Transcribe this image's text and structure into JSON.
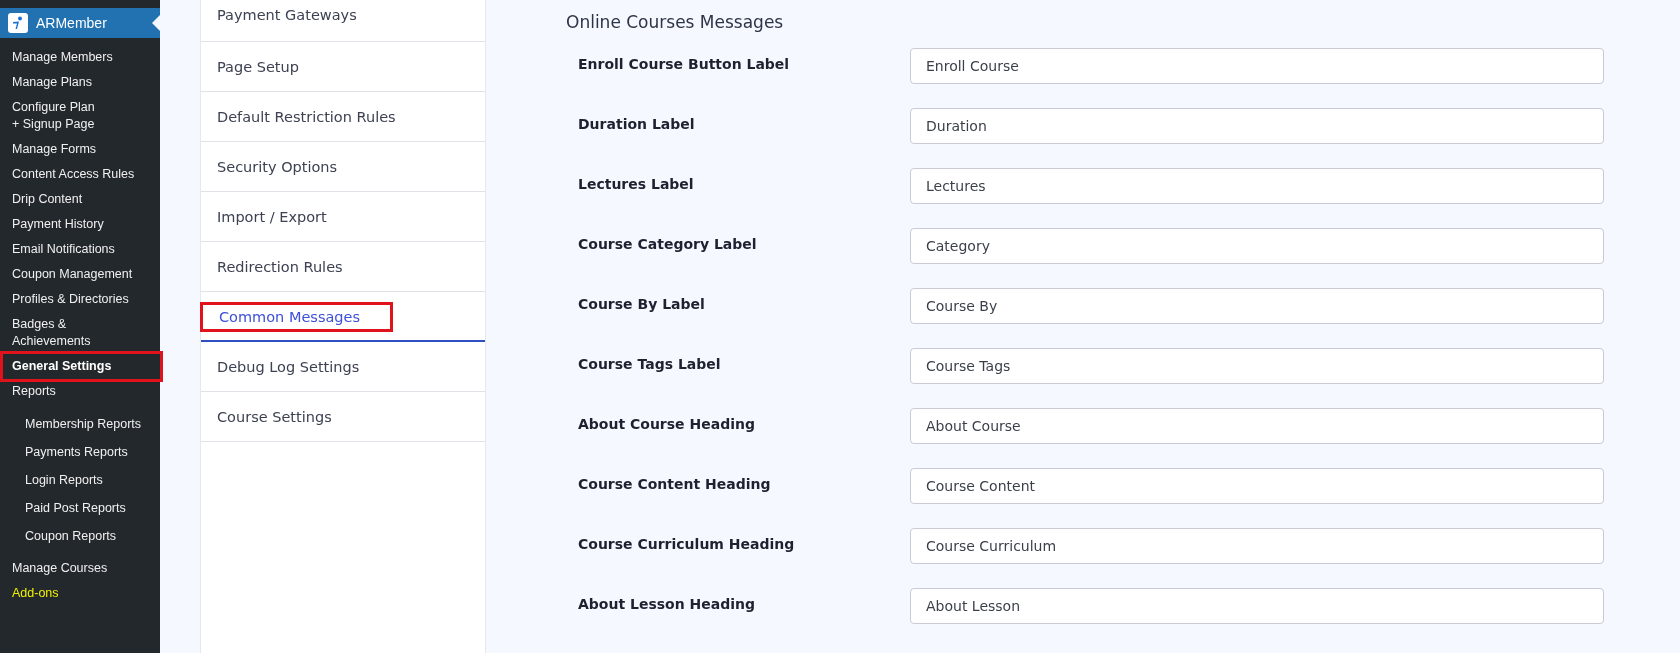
{
  "sidebar": {
    "header": {
      "title": "ARMember"
    },
    "items": [
      {
        "label": "Manage Members",
        "selected": false,
        "highlighted": false
      },
      {
        "label": "Manage Plans",
        "selected": false,
        "highlighted": false
      },
      {
        "label": "Configure Plan + Signup Page",
        "selected": false,
        "highlighted": false
      },
      {
        "label": "Manage Forms",
        "selected": false,
        "highlighted": false
      },
      {
        "label": "Content Access Rules",
        "selected": false,
        "highlighted": false
      },
      {
        "label": "Drip Content",
        "selected": false,
        "highlighted": false
      },
      {
        "label": "Payment History",
        "selected": false,
        "highlighted": false
      },
      {
        "label": "Email Notifications",
        "selected": false,
        "highlighted": false
      },
      {
        "label": "Coupon Management",
        "selected": false,
        "highlighted": false
      },
      {
        "label": "Profiles & Directories",
        "selected": false,
        "highlighted": false
      },
      {
        "label": "Badges & Achievements",
        "selected": false,
        "highlighted": false
      },
      {
        "label": "General Settings",
        "selected": true,
        "highlighted": true
      },
      {
        "label": "Reports",
        "selected": false,
        "highlighted": false,
        "children": [
          {
            "label": "Membership Reports"
          },
          {
            "label": "Payments Reports"
          },
          {
            "label": "Login Reports"
          },
          {
            "label": "Paid Post Reports"
          },
          {
            "label": "Coupon Reports"
          }
        ]
      },
      {
        "label": "Manage Courses",
        "selected": false,
        "highlighted": false
      },
      {
        "label": "Add-ons",
        "selected": false,
        "highlighted": false,
        "kind": "addon"
      }
    ]
  },
  "settings_menu": [
    {
      "label": "Payment Gateways",
      "selected": false,
      "highlighted": false
    },
    {
      "label": "Page Setup",
      "selected": false,
      "highlighted": false
    },
    {
      "label": "Default Restriction Rules",
      "selected": false,
      "highlighted": false
    },
    {
      "label": "Security Options",
      "selected": false,
      "highlighted": false
    },
    {
      "label": "Import / Export",
      "selected": false,
      "highlighted": false
    },
    {
      "label": "Redirection Rules",
      "selected": false,
      "highlighted": false
    },
    {
      "label": "Common Messages",
      "selected": true,
      "highlighted": true
    },
    {
      "label": "Debug Log Settings",
      "selected": false,
      "highlighted": false
    },
    {
      "label": "Course Settings",
      "selected": false,
      "highlighted": false
    }
  ],
  "section": {
    "title": "Online Courses Messages",
    "fields": [
      {
        "label": "Enroll Course Button Label",
        "value": "Enroll Course"
      },
      {
        "label": "Duration Label",
        "value": "Duration"
      },
      {
        "label": "Lectures Label",
        "value": "Lectures"
      },
      {
        "label": "Course Category Label",
        "value": "Category"
      },
      {
        "label": "Course By Label",
        "value": "Course By"
      },
      {
        "label": "Course Tags Label",
        "value": "Course Tags"
      },
      {
        "label": "About Course Heading",
        "value": "About Course"
      },
      {
        "label": "Course Content Heading",
        "value": "Course Content"
      },
      {
        "label": "Course Curriculum Heading",
        "value": "Course Curriculum"
      },
      {
        "label": "About Lesson Heading",
        "value": "About Lesson"
      }
    ]
  }
}
